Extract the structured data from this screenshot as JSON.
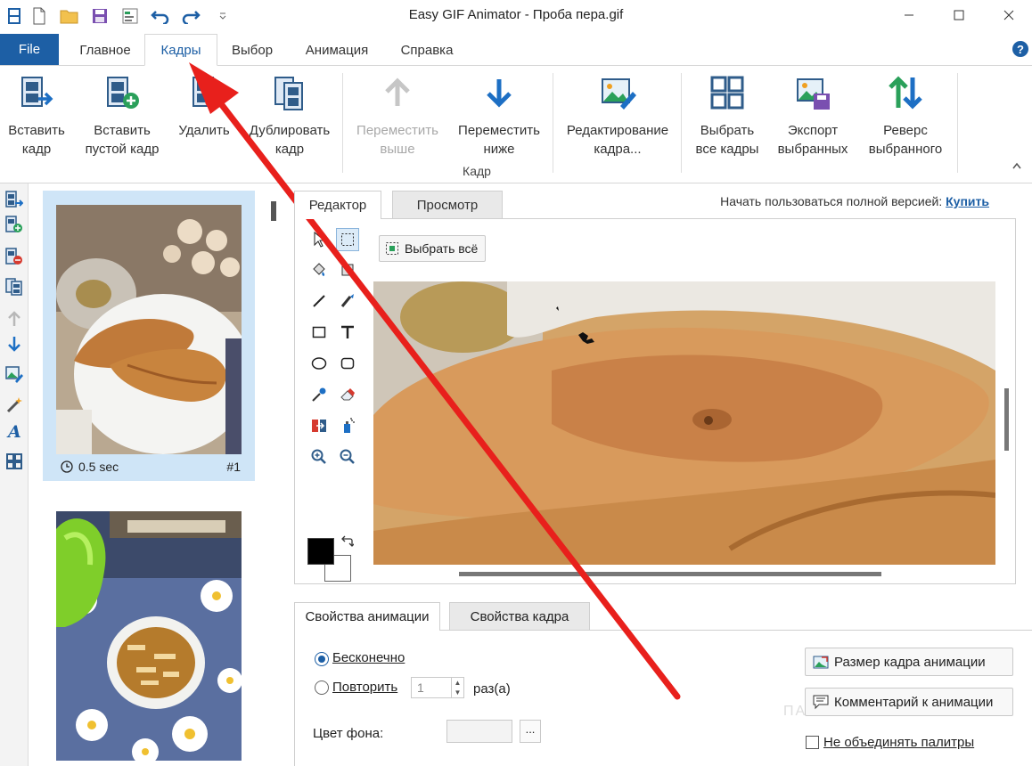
{
  "window": {
    "title": "Easy GIF Animator - Проба пера.gif"
  },
  "ribbon_tabs": {
    "file": "File",
    "home": "Главное",
    "frames": "Кадры",
    "select": "Выбор",
    "animation": "Анимация",
    "help": "Справка"
  },
  "ribbon": {
    "insert_frame": "Вставить\nкадр",
    "insert_blank": "Вставить\nпустой кадр",
    "delete": "Удалить",
    "duplicate": "Дублировать\nкадр",
    "move_up": "Переместить\nвыше",
    "move_down": "Переместить\nниже",
    "edit_frame": "Редактирование\nкадра...",
    "select_all_frames": "Выбрать\nвсе кадры",
    "export_selected": "Экспорт\nвыбранных",
    "reverse_selected": "Реверс\nвыбранного",
    "group_label": "Кадр"
  },
  "frames": [
    {
      "duration": "0.5 sec",
      "number": "#1",
      "selected": true
    },
    {
      "duration": "",
      "number": "",
      "selected": false
    }
  ],
  "editor": {
    "tab_editor": "Редактор",
    "tab_preview": "Просмотр",
    "promo_text": "Начать пользоваться полной версией:",
    "promo_link": "Купить",
    "select_all": "Выбрать всё"
  },
  "properties": {
    "tab_animation": "Свойства анимации",
    "tab_frame": "Свойства кадра",
    "loop_infinite": "Бесконечно",
    "loop_repeat": "Повторить",
    "repeat_count": "1",
    "repeat_unit": "раз(а)",
    "bg_color_label": "Цвет фона:",
    "bg_color_btn": "...",
    "frame_size_btn": "Размер кадра анимации",
    "comment_btn": "Комментарий к анимации",
    "no_merge_palettes": "Не объединять палитры",
    "loop_mode": "infinite"
  },
  "watermark": "ПАРТНЕРКИН",
  "colors": {
    "accent": "#1d5fa5",
    "annotation": "#e8201c",
    "selected_frame_bg": "#cfe5f7"
  }
}
